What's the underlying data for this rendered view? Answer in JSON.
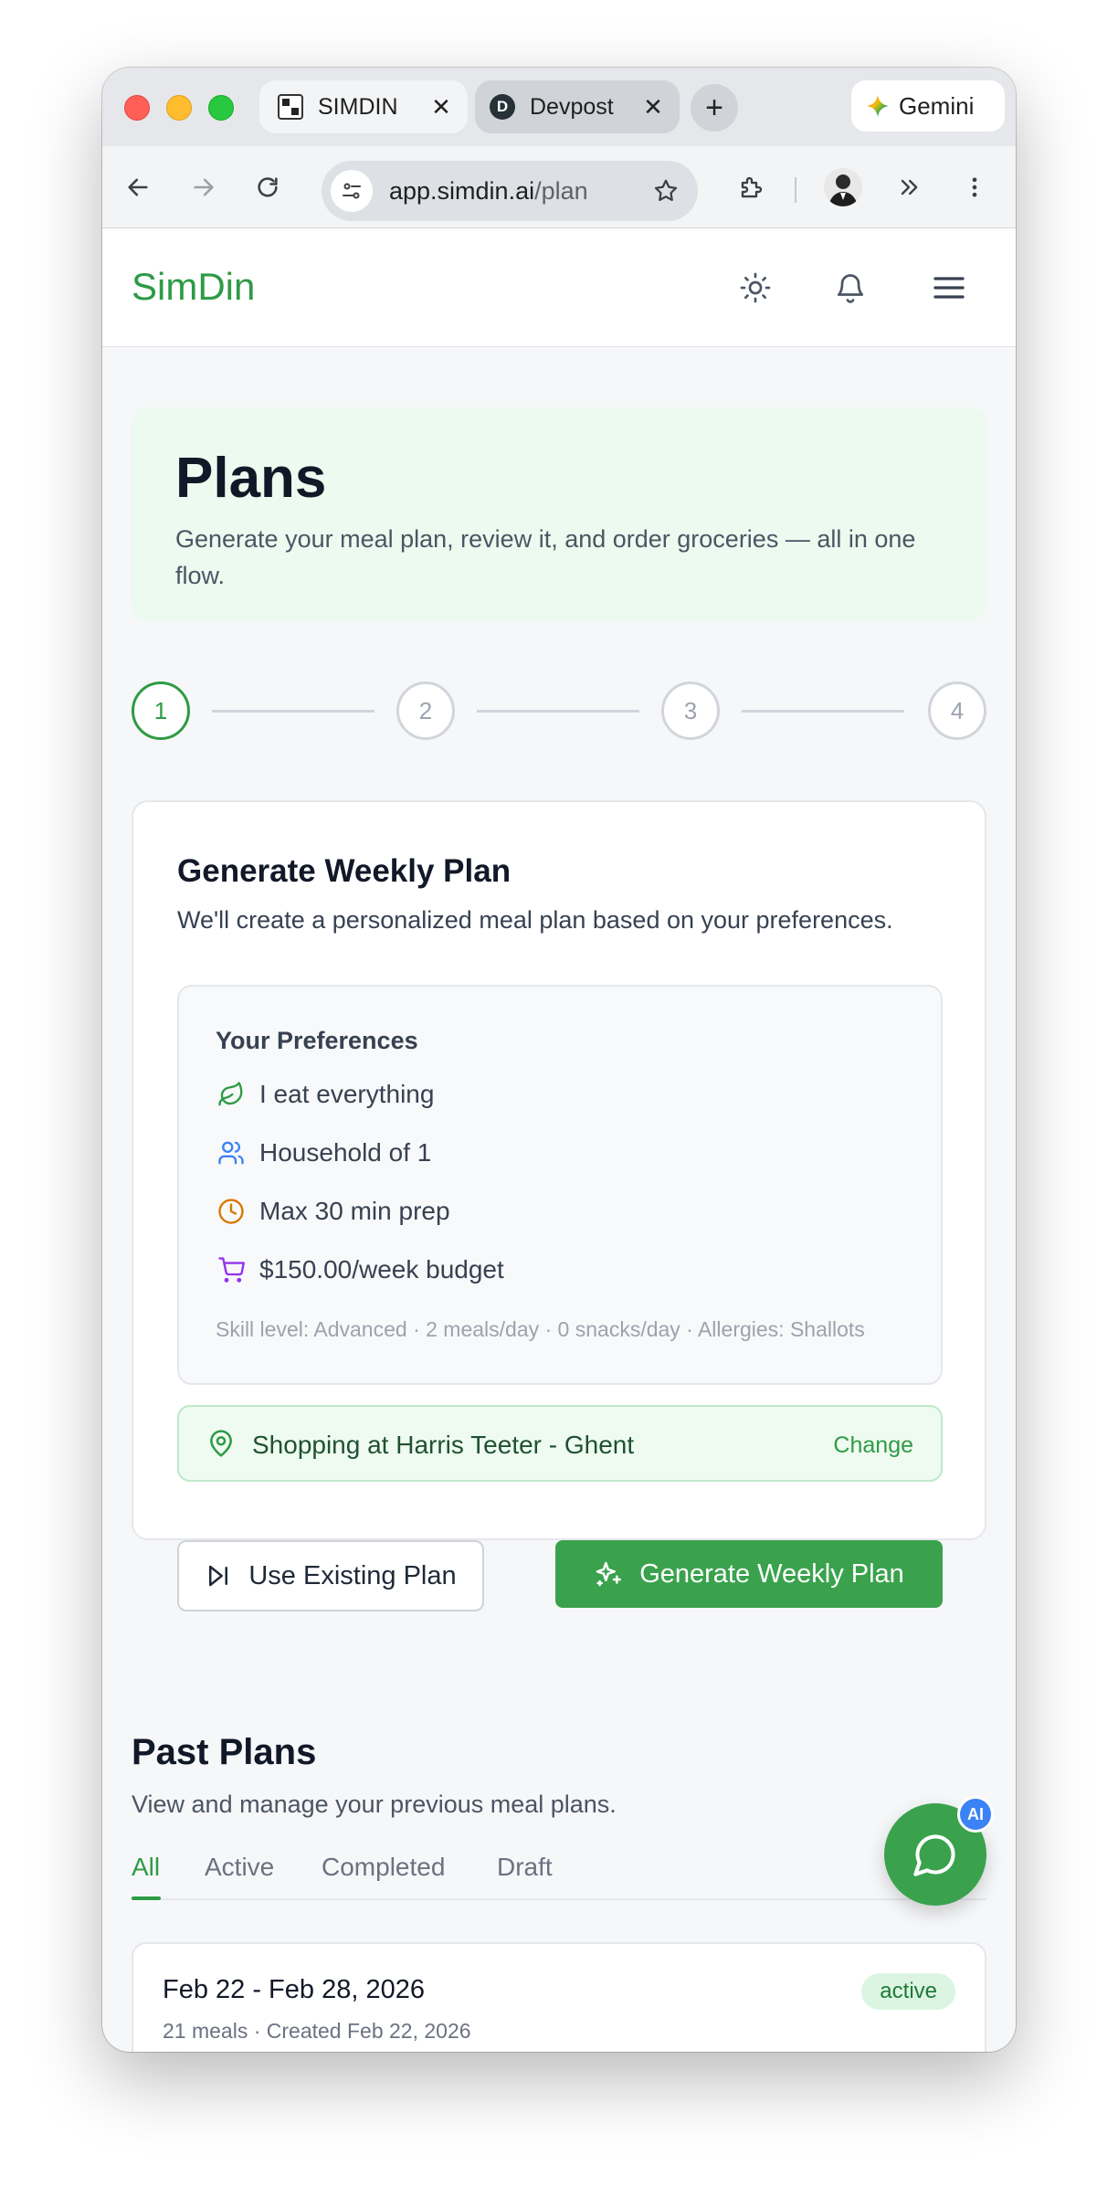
{
  "browser": {
    "tabs": [
      {
        "title": "SIMDIN",
        "close": "✕",
        "active": true
      },
      {
        "title": "Devpost",
        "close": "✕",
        "active": false,
        "favicon_letter": "D"
      }
    ],
    "new_tab_label": "+",
    "gemini_label": "Gemini",
    "url_host": "app.simdin.ai",
    "url_path": "/plan"
  },
  "app": {
    "brand": "SimDin",
    "brand_color": "#2e9b45",
    "header_icons": [
      "sun-icon",
      "bell-icon",
      "menu-icon"
    ]
  },
  "hero": {
    "title": "Plans",
    "subtitle": "Generate your meal plan, review it, and order groceries — all in one flow."
  },
  "stepper": {
    "steps": [
      "1",
      "2",
      "3",
      "4"
    ],
    "current": 1
  },
  "generate_card": {
    "title": "Generate Weekly Plan",
    "subtitle": "We'll create a personalized meal plan based on your preferences.",
    "preferences_title": "Your Preferences",
    "preferences": [
      {
        "icon": "leaf-icon",
        "label": "I eat everything",
        "color": "#2e9b45"
      },
      {
        "icon": "users-icon",
        "label": "Household of 1",
        "color": "#3b82f6"
      },
      {
        "icon": "clock-icon",
        "label": "Max 30 min prep",
        "color": "#d97706"
      },
      {
        "icon": "cart-icon",
        "label": "$150.00/week budget",
        "color": "#9333ea"
      }
    ],
    "meta": "Skill level: Advanced · 2 meals/day · 0 snacks/day · Allergies: Shallots",
    "store": {
      "label": "Shopping at Harris Teeter - Ghent",
      "change_label": "Change"
    },
    "use_existing_label": "Use Existing Plan",
    "generate_label": "Generate Weekly Plan"
  },
  "past_plans": {
    "title": "Past Plans",
    "subtitle": "View and manage your previous meal plans.",
    "tabs": [
      "All",
      "Active",
      "Completed",
      "Draft"
    ],
    "active_tab": "All",
    "items": [
      {
        "range": "Feb 22 - Feb 28, 2026",
        "info": "21 meals · Created Feb 22, 2026",
        "status": "active"
      }
    ]
  },
  "chat_fab": {
    "badge": "AI"
  }
}
